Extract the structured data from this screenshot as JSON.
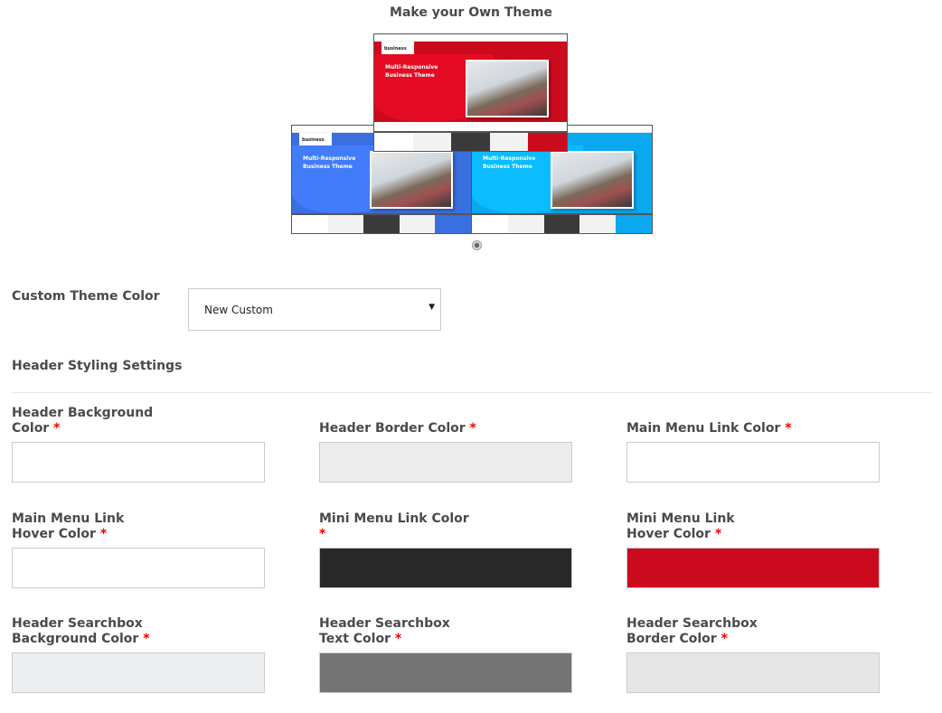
{
  "title": "Make your Own Theme",
  "thumbnails": [
    {
      "name": "red",
      "accent": "#cc0a1e",
      "hero_title": "Multi-Responsive Business Theme",
      "logo": "business",
      "swatches": [
        "#ffffff",
        "#f2f2f2",
        "#3a3a3a",
        "#f2f2f2",
        "#cc0a1e"
      ]
    },
    {
      "name": "blue",
      "accent": "#3a6fe0",
      "hero_title": "Multi-Responsive Business Theme",
      "logo": "business",
      "swatches": [
        "#ffffff",
        "#f2f2f2",
        "#3a3a3a",
        "#f2f2f2",
        "#3a6fe0"
      ]
    },
    {
      "name": "sky",
      "accent": "#0aa8ef",
      "hero_title": "Multi-Responsive Business Theme",
      "logo": "business",
      "swatches": [
        "#ffffff",
        "#f2f2f2",
        "#3a3a3a",
        "#f2f2f2",
        "#0aa8ef"
      ]
    }
  ],
  "custom_theme": {
    "label": "Custom Theme Color",
    "selected": "New Custom",
    "arrow": "▼"
  },
  "section_title": "Header Styling Settings",
  "required_mark": "*",
  "fields": [
    {
      "label": "Header Background Color",
      "color": "#ffffff"
    },
    {
      "label": "Header Border Color",
      "color": "#ececec"
    },
    {
      "label": "Main Menu Link Color",
      "color": "#ffffff"
    },
    {
      "label": "Main Menu Link Hover Color",
      "color": "#ffffff"
    },
    {
      "label": "Mini Menu Link Color",
      "color": "#282828"
    },
    {
      "label": "Mini Menu Link Hover Color",
      "color": "#cc0a1e"
    },
    {
      "label": "Header Searchbox Background Color",
      "color": "#eceeef"
    },
    {
      "label": "Header Searchbox Text Color",
      "color": "#747474"
    },
    {
      "label": "Header Searchbox Border Color",
      "color": "#e6e6e6"
    }
  ]
}
